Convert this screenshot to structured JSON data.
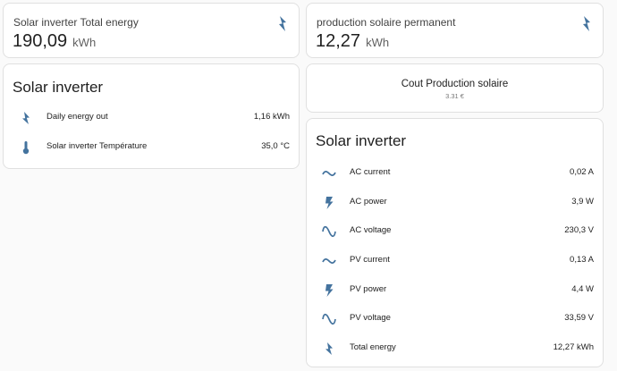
{
  "colors": {
    "icon": "#44739e",
    "card_bg": "#ffffff",
    "page_bg": "#fafafa",
    "border": "#e0e0e0"
  },
  "total_energy_card": {
    "name": "Solar inverter Total energy",
    "value": "190,09",
    "unit": "kWh",
    "icon": "lightning-bolt-icon"
  },
  "production_card": {
    "name": "production solaire permanent",
    "value": "12,27",
    "unit": "kWh",
    "icon": "lightning-bolt-icon"
  },
  "cout_card": {
    "title": "Cout Production solaire",
    "value": "3.31 €"
  },
  "left_entities": {
    "title": "Solar inverter",
    "rows": [
      {
        "label": "Daily energy out",
        "value": "1,16 kWh",
        "icon": "lightning-bolt-icon"
      },
      {
        "label": "Solar inverter Température",
        "value": "35,0 °C",
        "icon": "thermometer-icon"
      }
    ]
  },
  "right_entities": {
    "title": "Solar inverter",
    "rows": [
      {
        "label": "AC current",
        "value": "0,02 A",
        "icon": "current-ac-icon"
      },
      {
        "label": "AC power",
        "value": "3,9 W",
        "icon": "flash-icon"
      },
      {
        "label": "AC voltage",
        "value": "230,3 V",
        "icon": "sine-wave-icon"
      },
      {
        "label": "PV current",
        "value": "0,13 A",
        "icon": "current-ac-icon"
      },
      {
        "label": "PV power",
        "value": "4,4 W",
        "icon": "flash-icon"
      },
      {
        "label": "PV voltage",
        "value": "33,59 V",
        "icon": "sine-wave-icon"
      },
      {
        "label": "Total energy",
        "value": "12,27 kWh",
        "icon": "lightning-bolt-icon"
      }
    ]
  }
}
